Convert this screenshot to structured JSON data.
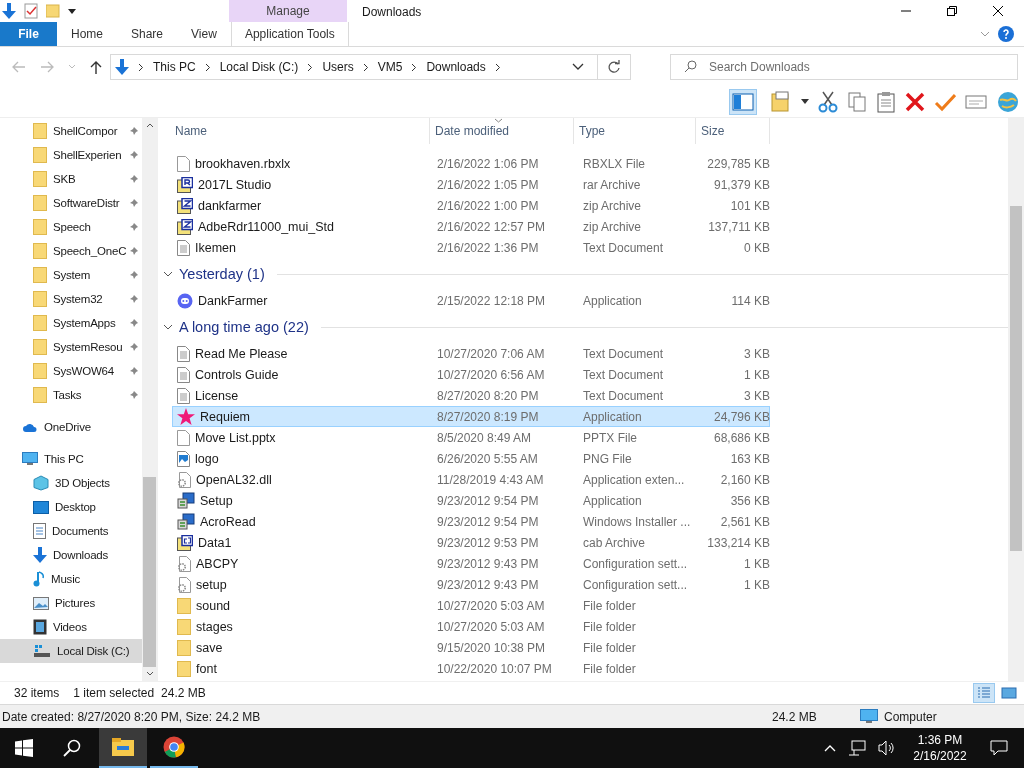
{
  "window": {
    "title": "Downloads"
  },
  "ribbon": {
    "context_header": "Manage",
    "tabs": [
      {
        "label": "File",
        "kind": "file",
        "selected": true
      },
      {
        "label": "Home",
        "kind": "plain",
        "selected": false
      },
      {
        "label": "Share",
        "kind": "plain",
        "selected": false
      },
      {
        "label": "View",
        "kind": "plain",
        "selected": false
      },
      {
        "label": "Application Tools",
        "kind": "context",
        "selected": false
      }
    ]
  },
  "address": {
    "crumbs": [
      "This PC",
      "Local Disk (C:)",
      "Users",
      "VM5",
      "Downloads"
    ]
  },
  "search": {
    "placeholder": "Search Downloads"
  },
  "sidebar": {
    "quick_access": [
      {
        "label": "ShellCompor",
        "pinned": true
      },
      {
        "label": "ShellExperien",
        "pinned": true
      },
      {
        "label": "SKB",
        "pinned": true
      },
      {
        "label": "SoftwareDistr",
        "pinned": true
      },
      {
        "label": "Speech",
        "pinned": true
      },
      {
        "label": "Speech_OneC",
        "pinned": true
      },
      {
        "label": "System",
        "pinned": true
      },
      {
        "label": "System32",
        "pinned": true
      },
      {
        "label": "SystemApps",
        "pinned": true
      },
      {
        "label": "SystemResou",
        "pinned": true
      },
      {
        "label": "SysWOW64",
        "pinned": true
      },
      {
        "label": "Tasks",
        "pinned": true
      }
    ],
    "onedrive": {
      "label": "OneDrive"
    },
    "this_pc": {
      "label": "This PC",
      "children": [
        {
          "label": "3D Objects",
          "kind": "objects",
          "selected": false
        },
        {
          "label": "Desktop",
          "kind": "desktop",
          "selected": false
        },
        {
          "label": "Documents",
          "kind": "documents",
          "selected": false
        },
        {
          "label": "Downloads",
          "kind": "downloads",
          "selected": false
        },
        {
          "label": "Music",
          "kind": "music",
          "selected": false
        },
        {
          "label": "Pictures",
          "kind": "pictures",
          "selected": false
        },
        {
          "label": "Videos",
          "kind": "videos",
          "selected": false
        },
        {
          "label": "Local Disk (C:)",
          "kind": "disk",
          "selected": true
        }
      ]
    }
  },
  "columns": [
    {
      "label": "Name",
      "sorted": false
    },
    {
      "label": "Date modified",
      "sorted": true
    },
    {
      "label": "Type",
      "sorted": false
    },
    {
      "label": "Size",
      "sorted": false
    }
  ],
  "groups": [
    {
      "rows": [
        {
          "name": "brookhaven.rbxlx",
          "date": "2/16/2022 1:06 PM",
          "type": "RBXLX File",
          "size": "229,785 KB",
          "kind": "file",
          "selected": false
        },
        {
          "name": "2017L Studio",
          "date": "2/16/2022 1:05 PM",
          "type": "rar Archive",
          "size": "91,379 KB",
          "kind": "rar",
          "selected": false
        },
        {
          "name": "dankfarmer",
          "date": "2/16/2022 1:00 PM",
          "type": "zip Archive",
          "size": "101 KB",
          "kind": "zip",
          "selected": false
        },
        {
          "name": "AdbeRdr11000_mui_Std",
          "date": "2/16/2022 12:57 PM",
          "type": "zip Archive",
          "size": "137,711 KB",
          "kind": "zip",
          "selected": false
        },
        {
          "name": "Ikemen",
          "date": "2/16/2022 1:36 PM",
          "type": "Text Document",
          "size": "0 KB",
          "kind": "text",
          "selected": false
        }
      ]
    },
    {
      "header": "Yesterday (1)",
      "rows": [
        {
          "name": "DankFarmer",
          "date": "2/15/2022 12:18 PM",
          "type": "Application",
          "size": "114 KB",
          "kind": "chat-app",
          "selected": false
        }
      ]
    },
    {
      "header": "A long time ago (22)",
      "rows": [
        {
          "name": "Read Me Please",
          "date": "10/27/2020 7:06 AM",
          "type": "Text Document",
          "size": "3 KB",
          "kind": "text",
          "selected": false
        },
        {
          "name": "Controls Guide",
          "date": "10/27/2020 6:56 AM",
          "type": "Text Document",
          "size": "1 KB",
          "kind": "text",
          "selected": false
        },
        {
          "name": "License",
          "date": "8/27/2020 8:20 PM",
          "type": "Text Document",
          "size": "3 KB",
          "kind": "text",
          "selected": false
        },
        {
          "name": "Requiem",
          "date": "8/27/2020 8:19 PM",
          "type": "Application",
          "size": "24,796 KB",
          "kind": "star",
          "selected": true
        },
        {
          "name": "Move List.pptx",
          "date": "8/5/2020 8:49 AM",
          "type": "PPTX File",
          "size": "68,686 KB",
          "kind": "file",
          "selected": false
        },
        {
          "name": "logo",
          "date": "6/26/2020 5:55 AM",
          "type": "PNG File",
          "size": "163 KB",
          "kind": "image",
          "selected": false
        },
        {
          "name": "OpenAL32.dll",
          "date": "11/28/2019 4:43 AM",
          "type": "Application exten...",
          "size": "2,160 KB",
          "kind": "config",
          "selected": false
        },
        {
          "name": "Setup",
          "date": "9/23/2012 9:54 PM",
          "type": "Application",
          "size": "356 KB",
          "kind": "installer",
          "selected": false
        },
        {
          "name": "AcroRead",
          "date": "9/23/2012 9:54 PM",
          "type": "Windows Installer ...",
          "size": "2,561 KB",
          "kind": "installer",
          "selected": false
        },
        {
          "name": "Data1",
          "date": "9/23/2012 9:53 PM",
          "type": "cab Archive",
          "size": "133,214 KB",
          "kind": "cab",
          "selected": false
        },
        {
          "name": "ABCPY",
          "date": "9/23/2012 9:43 PM",
          "type": "Configuration sett...",
          "size": "1 KB",
          "kind": "config",
          "selected": false
        },
        {
          "name": "setup",
          "date": "9/23/2012 9:43 PM",
          "type": "Configuration sett...",
          "size": "1 KB",
          "kind": "config",
          "selected": false
        },
        {
          "name": "sound",
          "date": "10/27/2020 5:03 AM",
          "type": "File folder",
          "kind": "folder",
          "selected": false
        },
        {
          "name": "stages",
          "date": "10/27/2020 5:03 AM",
          "type": "File folder",
          "kind": "folder",
          "selected": false
        },
        {
          "name": "save",
          "date": "9/15/2020 10:38 PM",
          "type": "File folder",
          "kind": "folder",
          "selected": false
        },
        {
          "name": "font",
          "date": "10/22/2020 10:07 PM",
          "type": "File folder",
          "kind": "folder",
          "selected": false
        }
      ]
    }
  ],
  "status_bar": {
    "items": "32 items",
    "selection": "1 item selected",
    "selection_size": "24.2 MB"
  },
  "details_bar": {
    "info": "Date created: 8/27/2020 8:20 PM, Size: 24.2 MB",
    "size": "24.2 MB",
    "location": "Computer"
  },
  "taskbar": {
    "apps": [
      {
        "kind": "explorer",
        "selected": true
      },
      {
        "kind": "browser",
        "selected": false
      }
    ],
    "time": "1:36 PM",
    "date": "2/16/2022"
  }
}
